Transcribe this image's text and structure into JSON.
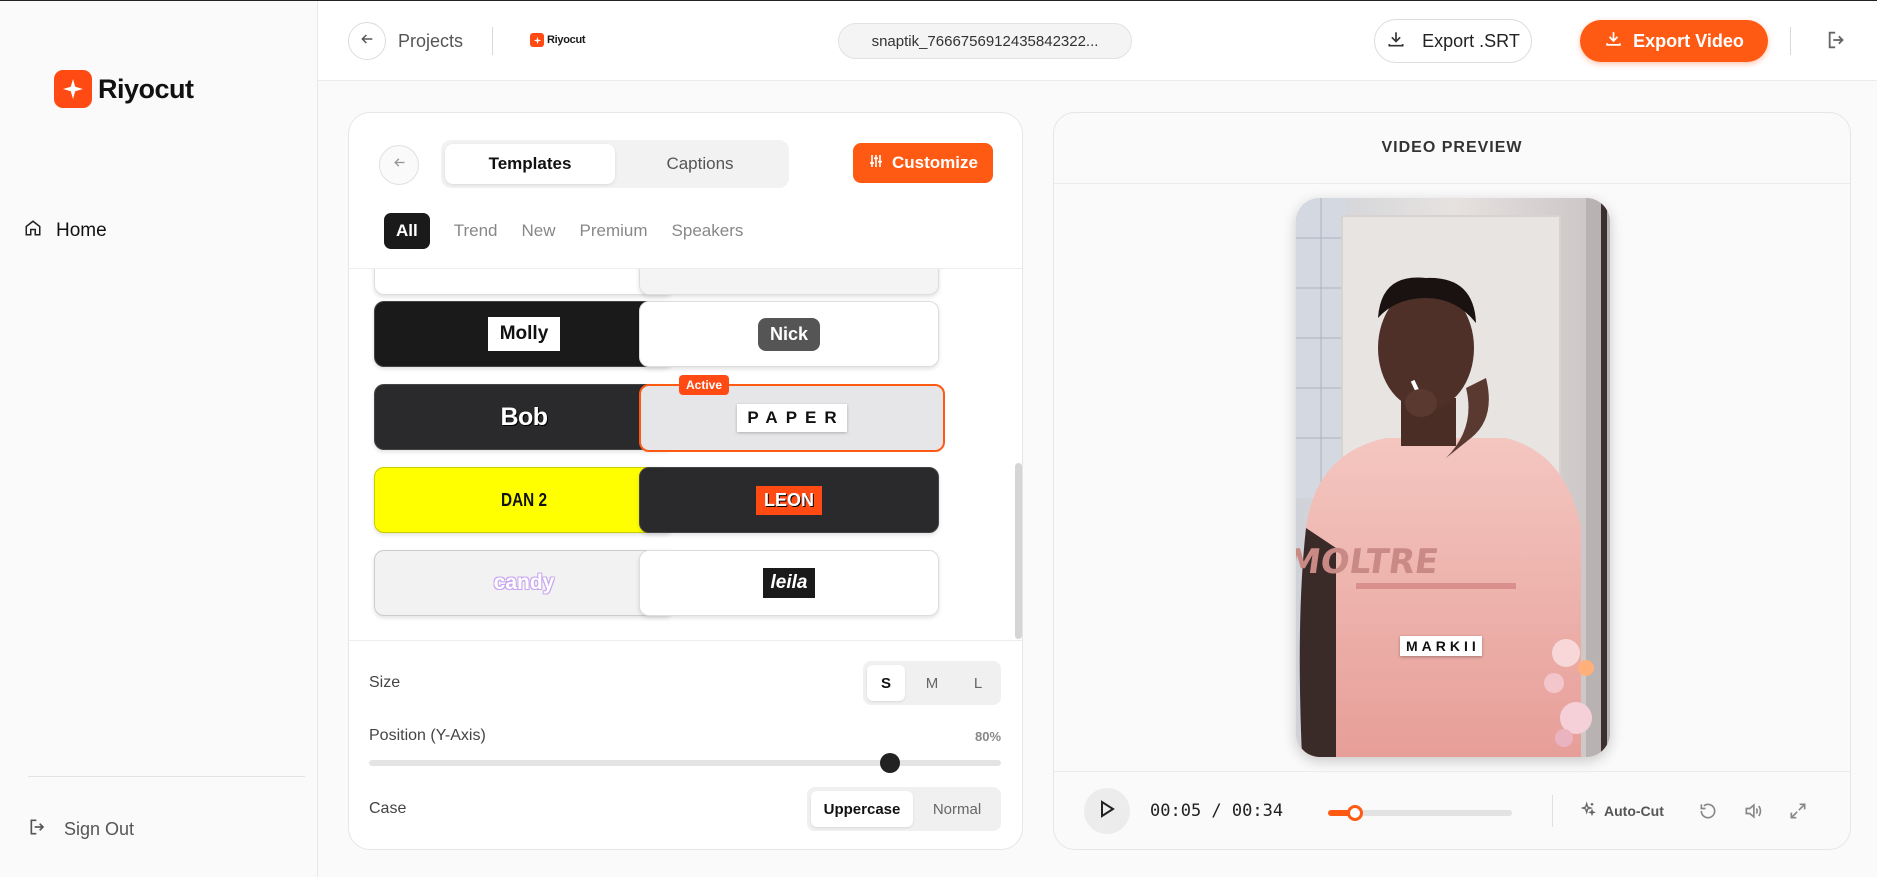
{
  "sidebar": {
    "logo_text": "Riyocut",
    "home_label": "Home",
    "signout_label": "Sign Out"
  },
  "header": {
    "projects_label": "Projects",
    "mini_logo_text": "Riyocut",
    "filename": "snaptik_7666756912435842322...",
    "export_srt_label": "Export .SRT",
    "export_video_label": "Export Video"
  },
  "panel": {
    "tabs": [
      {
        "label": "Templates",
        "active": true
      },
      {
        "label": "Captions",
        "active": false
      }
    ],
    "customize_label": "Customize",
    "filters": [
      "All",
      "Trend",
      "New",
      "Premium",
      "Speakers"
    ],
    "active_filter": "All",
    "active_badge": "Active",
    "templates": [
      {
        "name": "Molly"
      },
      {
        "name": "Nick"
      },
      {
        "name": "Bob"
      },
      {
        "name": "PAPER",
        "active": true
      },
      {
        "name": "DAN 2"
      },
      {
        "name": "LEON"
      },
      {
        "name": "candy"
      },
      {
        "name": "leila"
      }
    ],
    "size": {
      "label": "Size",
      "options": [
        "S",
        "M",
        "L"
      ],
      "selected": "S"
    },
    "position": {
      "label": "Position (Y-Axis)",
      "value_text": "80%",
      "value": 80
    },
    "case": {
      "label": "Case",
      "options": [
        "Uppercase",
        "Normal"
      ],
      "selected": "Uppercase"
    }
  },
  "preview": {
    "title": "VIDEO PREVIEW",
    "caption_word": "MARKII",
    "shirt_text": "MOLTRE",
    "timecode": "00:05 / 00:34",
    "progress_fraction": 0.147,
    "autocut_label": "Auto-Cut"
  },
  "colors": {
    "accent": "#ff5a14",
    "dark": "#1a1a1a"
  }
}
